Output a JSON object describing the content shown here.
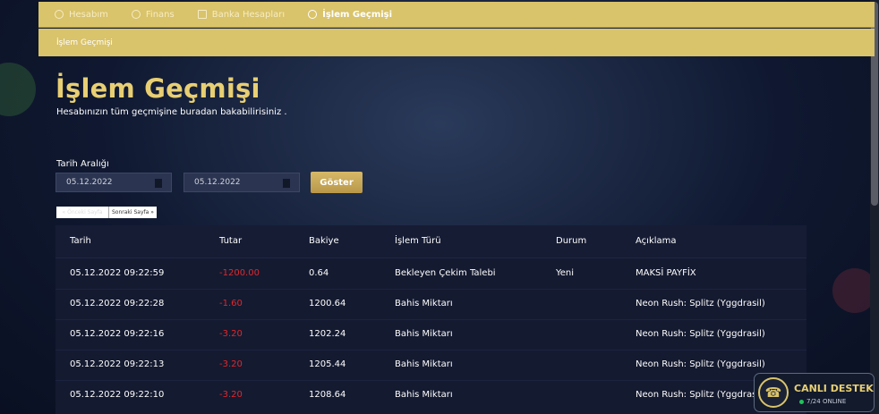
{
  "tabs": [
    {
      "label": "Hesabım",
      "icon": "user-icon"
    },
    {
      "label": "Finans",
      "icon": "coin-icon"
    },
    {
      "label": "Banka Hesapları",
      "icon": "bank-icon"
    },
    {
      "label": "İşlem Geçmişi",
      "icon": "history-icon"
    }
  ],
  "breadcrumb": "İşlem Geçmişi",
  "page": {
    "title": "İşlem Geçmişi",
    "subtitle": "Hesabınızın tüm geçmişine buradan bakabilirisiniz ."
  },
  "filter": {
    "label": "Tarih Aralığı",
    "start": "05.12.2022",
    "end": "05.12.2022",
    "button": "Göster"
  },
  "pager": {
    "prev": "« Önceki Sayfa",
    "next": "Sonraki Sayfa »"
  },
  "table": {
    "headers": [
      "Tarih",
      "Tutar",
      "Bakiye",
      "İşlem Türü",
      "Durum",
      "Açıklama"
    ],
    "rows": [
      [
        "05.12.2022 09:22:59",
        "-1200.00",
        "0.64",
        "Bekleyen Çekim Talebi",
        "Yeni",
        "MAKSİ PAYFİX"
      ],
      [
        "05.12.2022 09:22:28",
        "-1.60",
        "1200.64",
        "Bahis Miktarı",
        "",
        "Neon Rush: Splitz (Yggdrasil)"
      ],
      [
        "05.12.2022 09:22:16",
        "-3.20",
        "1202.24",
        "Bahis Miktarı",
        "",
        "Neon Rush: Splitz (Yggdrasil)"
      ],
      [
        "05.12.2022 09:22:13",
        "-3.20",
        "1205.44",
        "Bahis Miktarı",
        "",
        "Neon Rush: Splitz (Yggdrasil)"
      ],
      [
        "05.12.2022 09:22:10",
        "-3.20",
        "1208.64",
        "Bahis Miktarı",
        "",
        "Neon Rush: Splitz (Yggdrasil)"
      ]
    ]
  },
  "support": {
    "label": "CANLI DESTEK",
    "status": "7/24 ONLINE"
  },
  "colors": {
    "accent": "#d9c36b",
    "title": "#e8cf73",
    "negative": "#e0282d",
    "online": "#22c35a"
  }
}
